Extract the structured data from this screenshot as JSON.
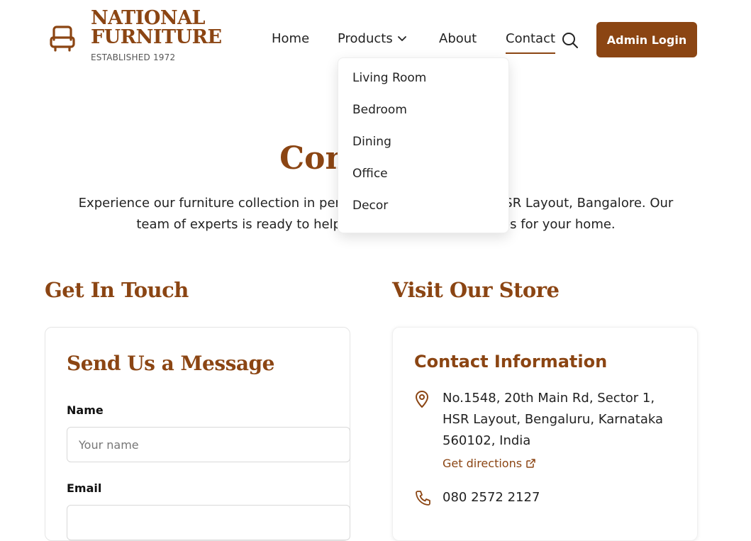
{
  "brand": {
    "line1": "NATIONAL",
    "line2": "FURNITURE",
    "tagline": "ESTABLISHED 1972",
    "icon": "sofa-icon"
  },
  "nav": {
    "home": "Home",
    "products": "Products",
    "about": "About",
    "contact": "Contact",
    "active": "Contact",
    "search_icon": "search-icon",
    "admin_login": "Admin Login"
  },
  "products_menu": {
    "items": [
      "Living Room",
      "Bedroom",
      "Dining",
      "Office",
      "Decor"
    ]
  },
  "hero": {
    "title": "Contact Us",
    "text": "Experience our furniture collection in person at our showroom in HSR Layout, Bangalore. Our team of experts is ready to help you find the perfect pieces for your home."
  },
  "sections": {
    "left_heading": "Get In Touch",
    "right_heading": "Visit Our Store"
  },
  "form": {
    "title": "Send Us a Message",
    "name_label": "Name",
    "name_placeholder": "Your name",
    "email_label": "Email"
  },
  "contact_info": {
    "title": "Contact Information",
    "address": "No.1548, 20th Main Rd, Sector 1, HSR Layout, Bengaluru, Karnataka 560102, India",
    "directions_link": "Get directions",
    "phone": "080 2572 2127"
  },
  "colors": {
    "brand": "#8b4513",
    "text": "#1f1f1f"
  }
}
